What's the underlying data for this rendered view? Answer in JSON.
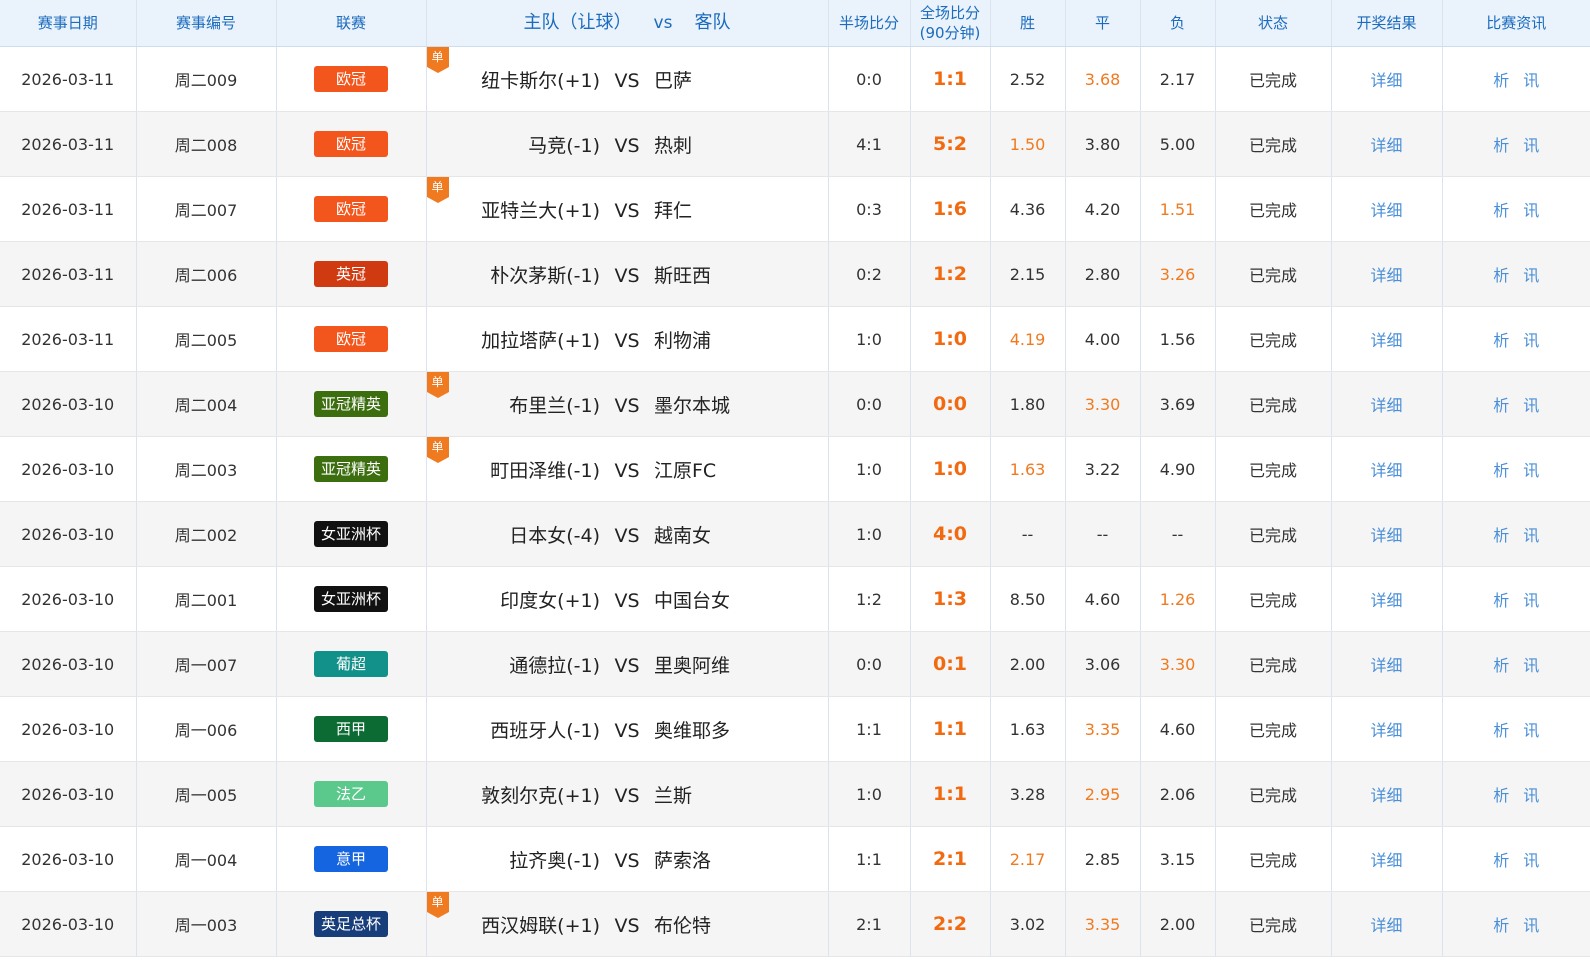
{
  "headers": {
    "date": "赛事日期",
    "number": "赛事编号",
    "league": "联赛",
    "home": "主队（让球）",
    "vs": "vs",
    "away": "客队",
    "half": "半场比分",
    "full_line1": "全场比分",
    "full_line2": "(90分钟)",
    "win": "胜",
    "draw": "平",
    "lose": "负",
    "status": "状态",
    "result": "开奖结果",
    "info": "比赛资讯"
  },
  "vs_label": "VS",
  "dan_label": "单",
  "detail_label": "详细",
  "analysis_label": "析",
  "news_label": "讯",
  "rows": [
    {
      "date": "2026-03-11",
      "number": "周二009",
      "league": "欧冠",
      "league_color": "#f2561d",
      "dan": true,
      "home": "纽卡斯尔(+1)",
      "away": "巴萨",
      "half": "0:0",
      "full": "1:1",
      "win": "2.52",
      "draw": "3.68",
      "lose": "2.17",
      "hl": "draw",
      "status": "已完成"
    },
    {
      "date": "2026-03-11",
      "number": "周二008",
      "league": "欧冠",
      "league_color": "#f2561d",
      "dan": false,
      "home": "马竞(-1)",
      "away": "热刺",
      "half": "4:1",
      "full": "5:2",
      "win": "1.50",
      "draw": "3.80",
      "lose": "5.00",
      "hl": "win",
      "status": "已完成"
    },
    {
      "date": "2026-03-11",
      "number": "周二007",
      "league": "欧冠",
      "league_color": "#f2561d",
      "dan": true,
      "home": "亚特兰大(+1)",
      "away": "拜仁",
      "half": "0:3",
      "full": "1:6",
      "win": "4.36",
      "draw": "4.20",
      "lose": "1.51",
      "hl": "lose",
      "status": "已完成"
    },
    {
      "date": "2026-03-11",
      "number": "周二006",
      "league": "英冠",
      "league_color": "#d03a10",
      "dan": false,
      "home": "朴次茅斯(-1)",
      "away": "斯旺西",
      "half": "0:2",
      "full": "1:2",
      "win": "2.15",
      "draw": "2.80",
      "lose": "3.26",
      "hl": "lose",
      "status": "已完成"
    },
    {
      "date": "2026-03-11",
      "number": "周二005",
      "league": "欧冠",
      "league_color": "#f2561d",
      "dan": false,
      "home": "加拉塔萨(+1)",
      "away": "利物浦",
      "half": "1:0",
      "full": "1:0",
      "win": "4.19",
      "draw": "4.00",
      "lose": "1.56",
      "hl": "win",
      "status": "已完成"
    },
    {
      "date": "2026-03-10",
      "number": "周二004",
      "league": "亚冠精英",
      "league_color": "#3c6e0f",
      "dan": true,
      "home": "布里兰(-1)",
      "away": "墨尔本城",
      "half": "0:0",
      "full": "0:0",
      "win": "1.80",
      "draw": "3.30",
      "lose": "3.69",
      "hl": "draw",
      "status": "已完成"
    },
    {
      "date": "2026-03-10",
      "number": "周二003",
      "league": "亚冠精英",
      "league_color": "#3c6e0f",
      "dan": true,
      "home": "町田泽维(-1)",
      "away": "江原FC",
      "half": "1:0",
      "full": "1:0",
      "win": "1.63",
      "draw": "3.22",
      "lose": "4.90",
      "hl": "win",
      "status": "已完成"
    },
    {
      "date": "2026-03-10",
      "number": "周二002",
      "league": "女亚洲杯",
      "league_color": "#111111",
      "dan": false,
      "home": "日本女(-4)",
      "away": "越南女",
      "half": "1:0",
      "full": "4:0",
      "win": "--",
      "draw": "--",
      "lose": "--",
      "hl": "none",
      "status": "已完成"
    },
    {
      "date": "2026-03-10",
      "number": "周二001",
      "league": "女亚洲杯",
      "league_color": "#111111",
      "dan": false,
      "home": "印度女(+1)",
      "away": "中国台女",
      "half": "1:2",
      "full": "1:3",
      "win": "8.50",
      "draw": "4.60",
      "lose": "1.26",
      "hl": "lose",
      "status": "已完成"
    },
    {
      "date": "2026-03-10",
      "number": "周一007",
      "league": "葡超",
      "league_color": "#12918a",
      "dan": false,
      "home": "通德拉(-1)",
      "away": "里奥阿维",
      "half": "0:0",
      "full": "0:1",
      "win": "2.00",
      "draw": "3.06",
      "lose": "3.30",
      "hl": "lose",
      "status": "已完成"
    },
    {
      "date": "2026-03-10",
      "number": "周一006",
      "league": "西甲",
      "league_color": "#0b6b33",
      "dan": false,
      "home": "西班牙人(-1)",
      "away": "奥维耶多",
      "half": "1:1",
      "full": "1:1",
      "win": "1.63",
      "draw": "3.35",
      "lose": "4.60",
      "hl": "draw",
      "status": "已完成"
    },
    {
      "date": "2026-03-10",
      "number": "周一005",
      "league": "法乙",
      "league_color": "#5cc98c",
      "dan": false,
      "home": "敦刻尔克(+1)",
      "away": "兰斯",
      "half": "1:0",
      "full": "1:1",
      "win": "3.28",
      "draw": "2.95",
      "lose": "2.06",
      "hl": "draw",
      "status": "已完成"
    },
    {
      "date": "2026-03-10",
      "number": "周一004",
      "league": "意甲",
      "league_color": "#1565e0",
      "dan": false,
      "home": "拉齐奥(-1)",
      "away": "萨索洛",
      "half": "1:1",
      "full": "2:1",
      "win": "2.17",
      "draw": "2.85",
      "lose": "3.15",
      "hl": "win",
      "status": "已完成"
    },
    {
      "date": "2026-03-10",
      "number": "周一003",
      "league": "英足总杯",
      "league_color": "#173d7a",
      "dan": true,
      "home": "西汉姆联(+1)",
      "away": "布伦特",
      "half": "2:1",
      "full": "2:2",
      "win": "3.02",
      "draw": "3.35",
      "lose": "2.00",
      "hl": "draw",
      "status": "已完成"
    }
  ]
}
